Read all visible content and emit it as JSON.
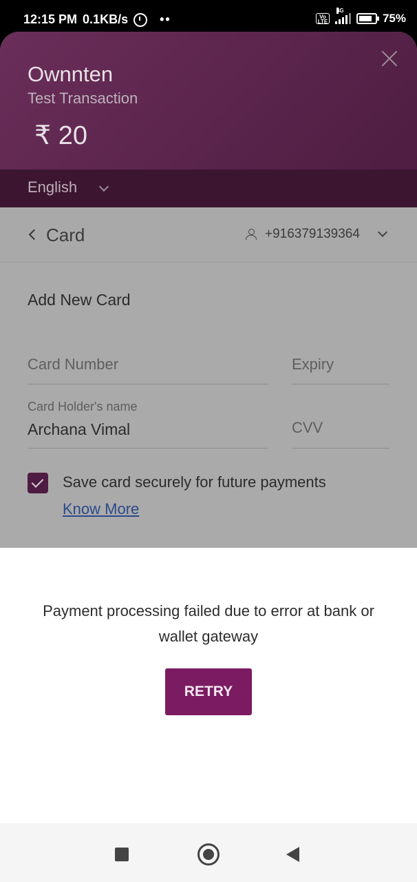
{
  "status_bar": {
    "time": "12:15 PM",
    "speed": "0.1KB/s",
    "dots": "••",
    "volte": "Vo LTE",
    "network": "4G",
    "battery": "75%"
  },
  "header": {
    "merchant": "Ownnten",
    "subtitle": "Test Transaction",
    "amount": "₹ 20",
    "close_icon": "close-icon",
    "language": "English"
  },
  "card_nav": {
    "title": "Card",
    "phone": "+916379139364"
  },
  "form": {
    "title": "Add New Card",
    "card_number_placeholder": "Card Number",
    "expiry_placeholder": "Expiry",
    "holder_label": "Card Holder's name",
    "holder_value": "Archana Vimal",
    "cvv_placeholder": "CVV",
    "save_card_label": "Save card securely for future payments",
    "save_card_checked": true,
    "know_more": "Know More"
  },
  "sheet": {
    "error_message": "Payment processing failed due to error at bank or wallet gateway",
    "retry_label": "RETRY"
  },
  "colors": {
    "brand": "#7b1c62",
    "header": "#5a2449"
  }
}
